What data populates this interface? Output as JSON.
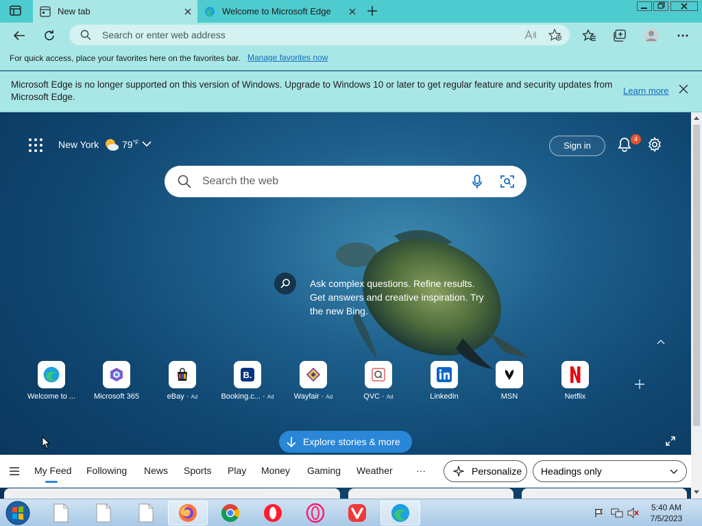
{
  "window": {
    "tabs": [
      {
        "title": "New tab",
        "active": true
      },
      {
        "title": "Welcome to Microsoft Edge",
        "active": false
      }
    ]
  },
  "toolbar": {
    "address_placeholder": "Search or enter web address"
  },
  "favorites_bar": {
    "message": "For quick access, place your favorites here on the favorites bar.",
    "link": "Manage favorites now"
  },
  "infobar": {
    "message": "Microsoft Edge is no longer supported on this version of Windows. Upgrade to Windows 10 or later to get regular feature and security updates from Microsoft Edge.",
    "link": "Learn more"
  },
  "newtab": {
    "location": "New York",
    "temperature": "79",
    "temp_unit": "°F",
    "sign_in": "Sign in",
    "notification_count": "4",
    "search_placeholder": "Search the web",
    "bing_message": "Ask complex questions. Refine results. Get answers and creative inspiration. Try the new Bing.",
    "explore": "Explore stories & more",
    "tiles": [
      {
        "label": "Welcome to ...",
        "ad": ""
      },
      {
        "label": "Microsoft 365",
        "ad": ""
      },
      {
        "label": "eBay",
        "ad": "Ad"
      },
      {
        "label": "Booking.c...",
        "ad": "Ad"
      },
      {
        "label": "Wayfair",
        "ad": "Ad"
      },
      {
        "label": "QVC",
        "ad": "Ad"
      },
      {
        "label": "LinkedIn",
        "ad": ""
      },
      {
        "label": "MSN",
        "ad": ""
      },
      {
        "label": "Netflix",
        "ad": ""
      }
    ]
  },
  "feed": {
    "tabs": [
      "My Feed",
      "Following",
      "News",
      "Sports",
      "Play",
      "Money",
      "Gaming",
      "Weather"
    ],
    "active_tab": "My Feed",
    "more": "···",
    "personalize": "Personalize",
    "headings": "Headings only"
  },
  "taskbar": {
    "time": "5:40 AM",
    "date": "7/5/2023"
  },
  "colors": {
    "accent": "#2a86d6",
    "chrome": "#a9e7e7",
    "tabstrip": "#4ecbcf",
    "link": "#0f6cbd"
  }
}
